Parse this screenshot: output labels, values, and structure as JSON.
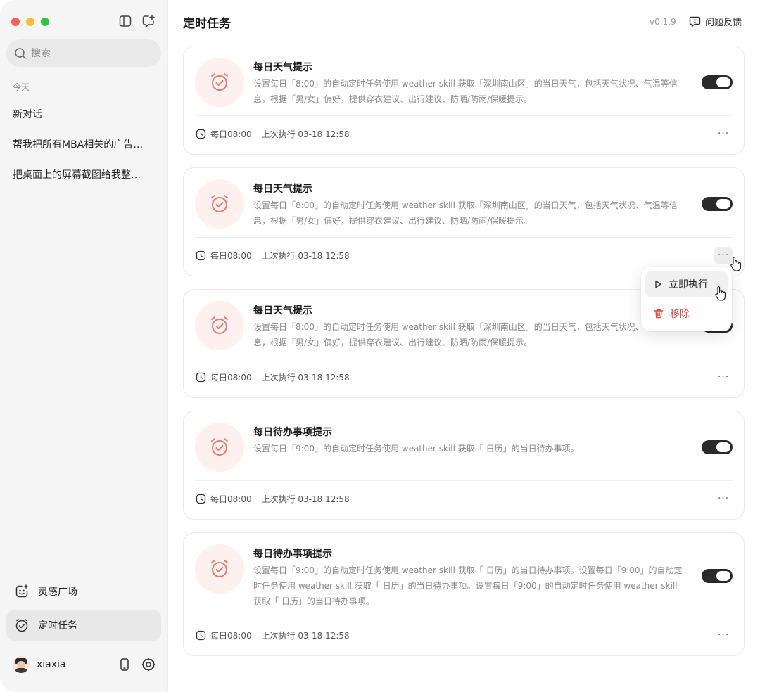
{
  "sidebar": {
    "search_placeholder": "搜索",
    "section_today": "今天",
    "chats": [
      {
        "label": "新对话"
      },
      {
        "label": "帮我把所有MBA相关的广告…"
      },
      {
        "label": "把桌面上的屏幕截图给我整…"
      }
    ],
    "nav": {
      "inspiration": "灵感广场",
      "scheduled": "定时任务"
    },
    "user": {
      "name": "xiaxia"
    }
  },
  "header": {
    "title": "定时任务",
    "version": "v0.1.9",
    "feedback": "问题反馈"
  },
  "tasks": [
    {
      "title": "每日天气提示",
      "desc": "设置每日「8:00」的自动定时任务使用 weather skill 获取「深圳南山区」的当日天气，包括天气状况、气温等信息，根据「男/女」偏好，提供穿衣建议、出行建议、防晒/防雨/保暖提示。",
      "schedule": "每日08:00",
      "last_run": "上次执行 03-18 12:58",
      "enabled": true
    },
    {
      "title": "每日天气提示",
      "desc": "设置每日「8:00」的自动定时任务使用 weather skill 获取「深圳南山区」的当日天气，包括天气状况、气温等信息，根据「男/女」偏好，提供穿衣建议、出行建议、防晒/防雨/保暖提示。",
      "schedule": "每日08:00",
      "last_run": "上次执行 03-18 12:58",
      "enabled": true
    },
    {
      "title": "每日天气提示",
      "desc": "设置每日「8:00」的自动定时任务使用 weather skill 获取「深圳南山区」的当日天气，包括天气状况、气温等信息，根据「男/女」偏好，提供穿衣建议、出行建议、防晒/防雨/保暖提示。",
      "schedule": "每日08:00",
      "last_run": "上次执行 03-18 12:58",
      "enabled": true
    },
    {
      "title": "每日待办事项提示",
      "desc": "设置每日「9:00」的自动定时任务使用 weather skill 获取「 日历」的当日待办事项。",
      "schedule": "每日08:00",
      "last_run": "上次执行 03-18 12:58",
      "enabled": true
    },
    {
      "title": "每日待办事项提示",
      "desc": "设置每日「9:00」的自动定时任务使用 weather skill 获取「 日历」的当日待办事项。设置每日「9:00」的自动定时任务使用 weather skill 获取「 日历」的当日待办事项。设置每日「9:00」的自动定时任务使用 weather skill 获取「 日历」的当日待办事项。",
      "schedule": "每日08:00",
      "last_run": "上次执行 03-18 12:58",
      "enabled": true
    }
  ],
  "menu": {
    "run_now": "立即执行",
    "remove": "移除"
  },
  "more_glyph": "···",
  "colors": {
    "accent_red": "#e0463e",
    "alarm_bg": "#fdf0ee",
    "toggle_on": "#2a2a2a"
  }
}
